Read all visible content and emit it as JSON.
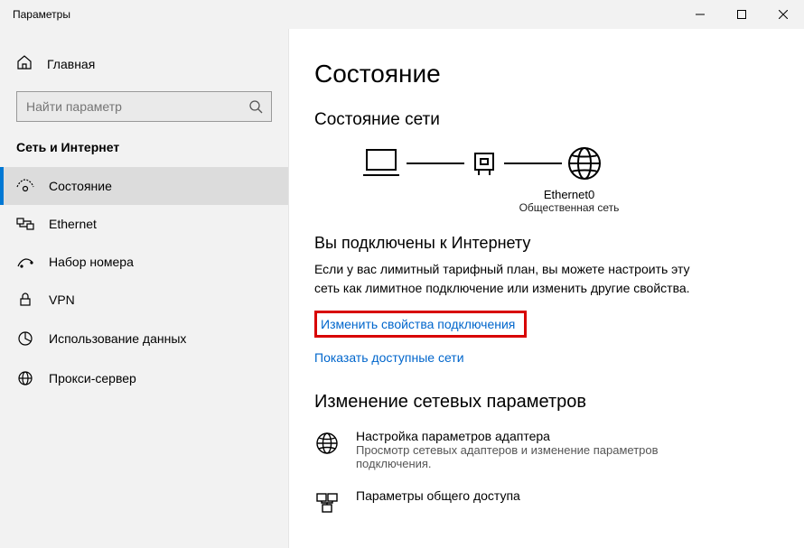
{
  "titlebar": {
    "title": "Параметры"
  },
  "sidebar": {
    "home_label": "Главная",
    "search_placeholder": "Найти параметр",
    "section_title": "Сеть и Интернет",
    "items": [
      {
        "label": "Состояние"
      },
      {
        "label": "Ethernet"
      },
      {
        "label": "Набор номера"
      },
      {
        "label": "VPN"
      },
      {
        "label": "Использование данных"
      },
      {
        "label": "Прокси-сервер"
      }
    ]
  },
  "content": {
    "page_title": "Состояние",
    "network_status_heading": "Состояние сети",
    "connection_name": "Ethernet0",
    "connection_type": "Общественная сеть",
    "connected_heading": "Вы подключены к Интернету",
    "connected_body": "Если у вас лимитный тарифный план, вы можете настроить эту сеть как лимитное подключение или изменить другие свойства.",
    "link_change_props": "Изменить свойства подключения",
    "link_show_networks": "Показать доступные сети",
    "change_settings_heading": "Изменение сетевых параметров",
    "options": [
      {
        "title": "Настройка параметров адаптера",
        "desc": "Просмотр сетевых адаптеров и изменение параметров подключения."
      },
      {
        "title": "Параметры общего доступа",
        "desc": ""
      }
    ]
  }
}
